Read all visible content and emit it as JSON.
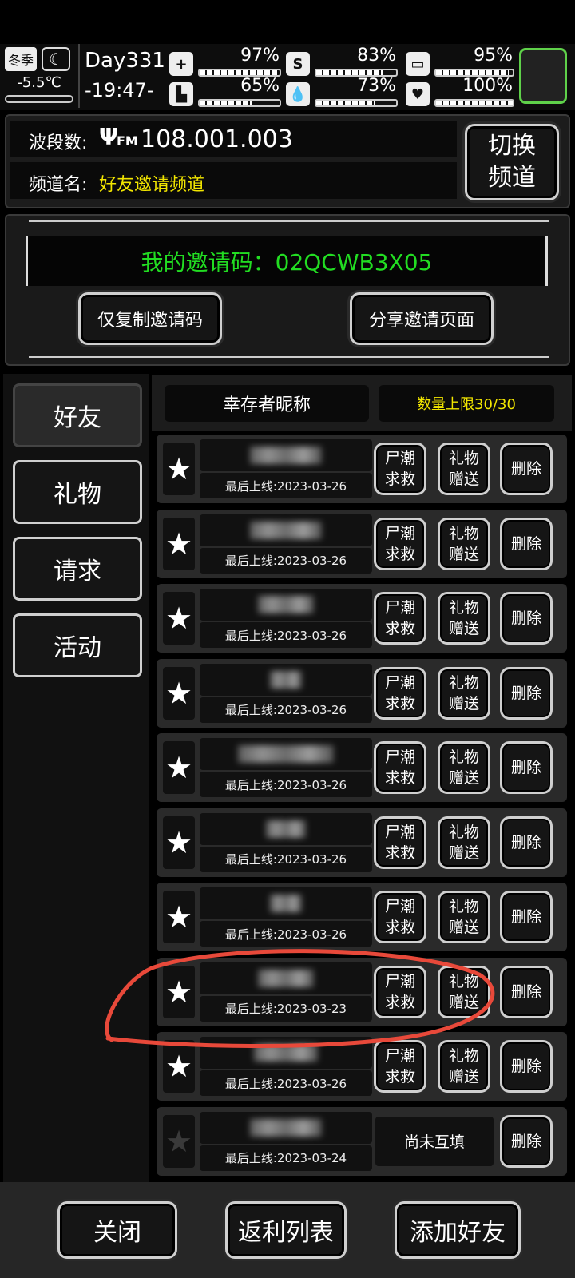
{
  "status": {
    "season": "冬季",
    "temperature": "-5.5℃",
    "day": "Day331",
    "time": "-19:47-",
    "stats": [
      {
        "icon": "health-icon",
        "glyph": "+",
        "value": "97%",
        "fill": 0.97
      },
      {
        "icon": "stomach-icon",
        "glyph": "S",
        "value": "83%",
        "fill": 0.83
      },
      {
        "icon": "battery-icon",
        "glyph": "▭",
        "value": "95%",
        "fill": 0.95
      },
      {
        "icon": "boot-icon",
        "glyph": "▙",
        "value": "65%",
        "fill": 0.65
      },
      {
        "icon": "water-drop-icon",
        "glyph": "💧",
        "value": "73%",
        "fill": 0.73
      },
      {
        "icon": "heart-icon",
        "glyph": "♥",
        "value": "100%",
        "fill": 1.0
      }
    ]
  },
  "radio": {
    "band_label": "波段数:",
    "fm_label": "FM",
    "frequency": "108.001.003",
    "channel_label": "频道名:",
    "channel_name": "好友邀请频道",
    "switch_button": "切换\n频道"
  },
  "invite": {
    "code_text": "我的邀请码：02QCWB3X05",
    "copy_button": "仅复制邀请码",
    "share_button": "分享邀请页面"
  },
  "tabs": [
    "好友",
    "礼物",
    "请求",
    "活动"
  ],
  "list_header": {
    "name_column": "幸存者昵称",
    "limit": "数量上限30/30"
  },
  "friends": [
    {
      "last_online": "最后上线:2023-03-26",
      "starred": true,
      "actions": [
        "尸潮\n求救",
        "礼物\n赠送"
      ],
      "delete": "删除"
    },
    {
      "last_online": "最后上线:2023-03-26",
      "starred": true,
      "actions": [
        "尸潮\n求救",
        "礼物\n赠送"
      ],
      "delete": "删除"
    },
    {
      "last_online": "最后上线:2023-03-26",
      "starred": true,
      "actions": [
        "尸潮\n求救",
        "礼物\n赠送"
      ],
      "delete": "删除"
    },
    {
      "last_online": "最后上线:2023-03-26",
      "starred": true,
      "actions": [
        "尸潮\n求救",
        "礼物\n赠送"
      ],
      "delete": "删除"
    },
    {
      "last_online": "最后上线:2023-03-26",
      "starred": true,
      "actions": [
        "尸潮\n求救",
        "礼物\n赠送"
      ],
      "delete": "删除"
    },
    {
      "last_online": "最后上线:2023-03-26",
      "starred": true,
      "actions": [
        "尸潮\n求救",
        "礼物\n赠送"
      ],
      "delete": "删除"
    },
    {
      "last_online": "最后上线:2023-03-26",
      "starred": true,
      "actions": [
        "尸潮\n求救",
        "礼物\n赠送"
      ],
      "delete": "删除"
    },
    {
      "last_online": "最后上线:2023-03-23",
      "starred": true,
      "actions": [
        "尸潮\n求救",
        "礼物\n赠送"
      ],
      "delete": "删除"
    },
    {
      "last_online": "最后上线:2023-03-26",
      "starred": true,
      "actions": [
        "尸潮\n求救",
        "礼物\n赠送"
      ],
      "delete": "删除"
    },
    {
      "last_online": "最后上线:2023-03-24",
      "starred": false,
      "pending": "尚未互填",
      "delete": "删除"
    }
  ],
  "bottom": {
    "close": "关闭",
    "rebate": "返利列表",
    "add_friend": "添加好友"
  },
  "colors": {
    "accent_green": "#22dd22",
    "channel_yellow": "#f2e600",
    "annotation_red": "#e8493a"
  }
}
